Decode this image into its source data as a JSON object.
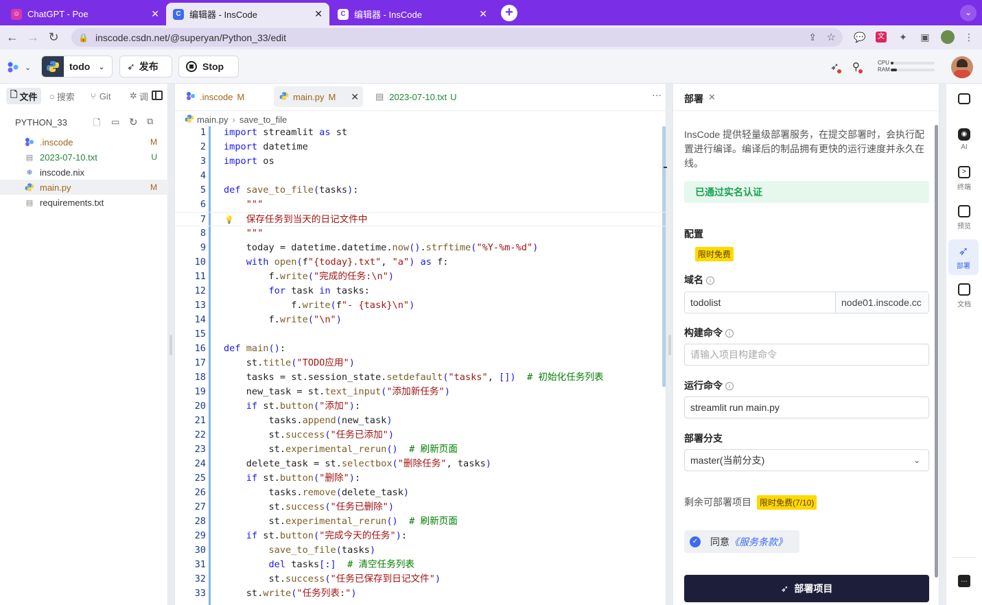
{
  "browser": {
    "tabs": [
      {
        "title": "ChatGPT - Poe",
        "active": false
      },
      {
        "title": "编辑器 - InsCode",
        "active": true
      },
      {
        "title": "编辑器 - InsCode",
        "active": false
      }
    ],
    "url": "inscode.csdn.net/@superyan/Python_33/edit"
  },
  "header": {
    "project": "todo",
    "publish_label": "发布",
    "stop_label": "Stop",
    "cpu_label": "CPU",
    "ram_label": "RAM"
  },
  "explorer": {
    "tabs": {
      "files": "文件",
      "search": "搜索",
      "git": "Git",
      "debug": "调"
    },
    "project_name": "PYTHON_33",
    "files": [
      {
        "name": ".inscode",
        "status": "M",
        "color": "#a0641a"
      },
      {
        "name": "2023-07-10.txt",
        "status": "U",
        "color": "#238636"
      },
      {
        "name": "inscode.nix",
        "status": "",
        "color": "#333333"
      },
      {
        "name": "main.py",
        "status": "M",
        "color": "#a0641a"
      },
      {
        "name": "requirements.txt",
        "status": "",
        "color": "#333333"
      }
    ]
  },
  "editor": {
    "tabs": [
      {
        "name": ".inscode",
        "status": "M"
      },
      {
        "name": "main.py",
        "status": "M"
      },
      {
        "name": "2023-07-10.txt",
        "status": "U"
      }
    ],
    "breadcrumb": [
      "main.py",
      "save_to_file"
    ],
    "line_numbers": [
      "1",
      "2",
      "3",
      "4",
      "5",
      "6",
      "7",
      "8",
      "9",
      "10",
      "11",
      "12",
      "13",
      "14",
      "15",
      "16",
      "17",
      "18",
      "19",
      "20",
      "21",
      "22",
      "23",
      "24",
      "25",
      "26",
      "27",
      "28",
      "29",
      "30",
      "31",
      "32",
      "33"
    ],
    "lines": [
      "import streamlit as st",
      "import datetime",
      "import os",
      "",
      "def save_to_file(tasks):",
      "    \"\"\"",
      "    保存任务到当天的日记文件中",
      "    \"\"\"",
      "    today = datetime.datetime.now().strftime(\"%Y-%m-%d\")",
      "    with open(f\"{today}.txt\", \"a\") as f:",
      "        f.write(\"完成的任务:\\n\")",
      "        for task in tasks:",
      "            f.write(f\"- {task}\\n\")",
      "        f.write(\"\\n\")",
      "",
      "def main():",
      "    st.title(\"TODO应用\")",
      "    tasks = st.session_state.setdefault(\"tasks\", [])  # 初始化任务列表",
      "    new_task = st.text_input(\"添加新任务\")",
      "    if st.button(\"添加\"):",
      "        tasks.append(new_task)",
      "        st.success(\"任务已添加\")",
      "        st.experimental_rerun()  # 刷新页面",
      "    delete_task = st.selectbox(\"删除任务\", tasks)",
      "    if st.button(\"删除\"):",
      "        tasks.remove(delete_task)",
      "        st.success(\"任务已删除\")",
      "        st.experimental_rerun()  # 刷新页面",
      "    if st.button(\"完成今天的任务\"):",
      "        save_to_file(tasks)",
      "        del tasks[:]  # 清空任务列表",
      "        st.success(\"任务已保存到日记文件\")",
      "    st.write(\"任务列表:\")"
    ]
  },
  "deploy": {
    "title": "部署",
    "description": "InsCode 提供轻量级部署服务，在提交部署时，会执行配置进行编译。编译后的制品拥有更快的运行速度并永久在线。",
    "verified": "已通过实名认证",
    "config_label": "配置",
    "config_badge": "限时免费",
    "domain_label": "域名",
    "domain_value": "todolist",
    "domain_suffix": "node01.inscode.cc",
    "build_label": "构建命令",
    "build_placeholder": "请输入项目构建命令",
    "run_label": "运行命令",
    "run_value": "streamlit run main.py",
    "branch_label": "部署分支",
    "branch_value": "master(当前分支)",
    "remaining_label": "剩余可部署项目",
    "remaining_badge": "限时免费(7/10)",
    "agree_label": "同意",
    "terms_label": "《服务条款》",
    "submit_label": "部署项目"
  },
  "rightbar": [
    {
      "icon": "robot-icon",
      "label": "AI"
    },
    {
      "icon": "terminal-icon",
      "label": "终端"
    },
    {
      "icon": "monitor-icon",
      "label": "预览"
    },
    {
      "icon": "rocket-icon",
      "label": "部署"
    },
    {
      "icon": "book-icon",
      "label": "文档"
    }
  ]
}
